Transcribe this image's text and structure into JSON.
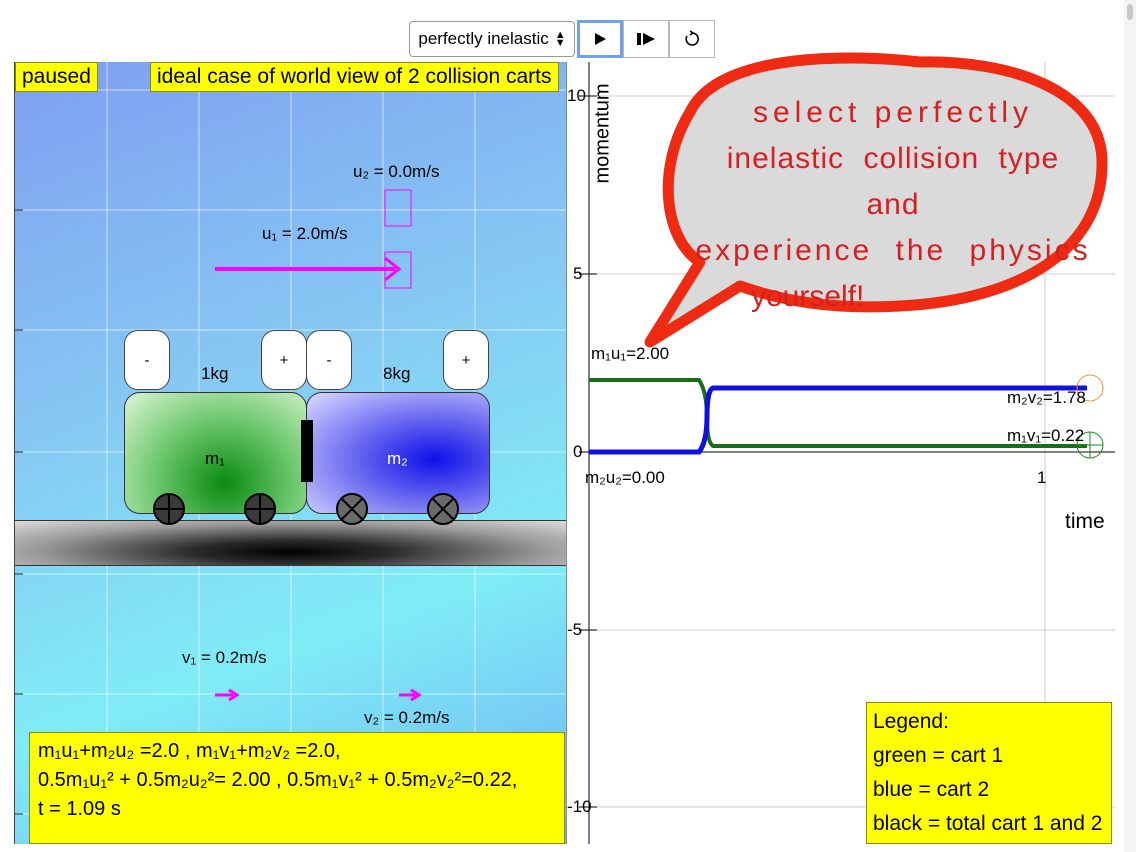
{
  "toolbar": {
    "collision_type": "perfectly inelastic",
    "play_label": "▶",
    "step_label": "▮▶",
    "reset_label": "↻"
  },
  "world": {
    "status": "paused",
    "title": "ideal case of world view of 2 collision carts",
    "u2_text": "u₂ = 0.0m/s",
    "u1_text": "u₁ = 2.0m/s",
    "v1_text": "v₁ = 0.2m/s",
    "v2_text": "v₂ = 0.2m/s",
    "cart1": {
      "mass": "1kg",
      "label": "m₁",
      "minus": "-",
      "plus": "+",
      "color": "#0a8a12"
    },
    "cart2": {
      "mass": "8kg",
      "label": "m₂",
      "minus": "-",
      "plus": "+",
      "color": "#1010e8"
    },
    "arrow_color": "#ff00ff",
    "info_line1": "m₁u₁+m₂u₂ =2.0 , m₁v₁+m₂v₂ =2.0,",
    "info_line2": "0.5m₁u₁² + 0.5m₂u₂²= 2.00 , 0.5m₁v₁² + 0.5m₂v₂²=0.22,",
    "info_line3": "t = 1.09 s"
  },
  "graph": {
    "y_axis_label": "momentum",
    "x_axis_label": "time",
    "y_ticks": [
      "10",
      "5",
      "0",
      "-5",
      "-10"
    ],
    "x_ticks": [
      "0",
      "1"
    ],
    "m1u1_label": "m₁u₁=2.00",
    "m2u2_label": "m₂u₂=0.00",
    "m2v2_label": "m₂v₂=1.78",
    "m1v1_label": "m₁v₁=0.22",
    "callout_line1": "select perfectly",
    "callout_line2": "inelastic collision type and",
    "callout_line3": "experience the physics",
    "callout_line4": "yourself!",
    "callout_color": "#ee2a12",
    "legend": {
      "title": "Legend:",
      "green": "green = cart 1",
      "blue": "blue = cart 2",
      "black": "black = total cart 1 and 2"
    },
    "series_colors": {
      "cart1": "#1a6e1a",
      "cart2": "#1010e0"
    }
  }
}
